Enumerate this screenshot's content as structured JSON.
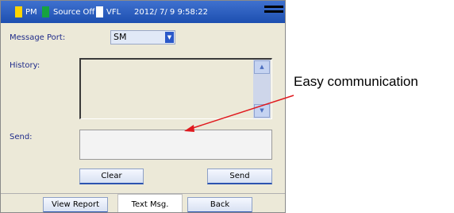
{
  "status_bar": {
    "pm_label": "PM",
    "source_label": "Source Off",
    "vfl_label": "VFL",
    "datetime": "2012/ 7/ 9  9:58:22",
    "colors": {
      "pm": "#ffd400",
      "source": "#16a340",
      "vfl": "#ffffff",
      "bar": "#1d4fb0"
    }
  },
  "form": {
    "message_port_label": "Message Port:",
    "message_port_value": "SM",
    "history_label": "History:",
    "send_label": "Send:"
  },
  "buttons": {
    "clear": "Clear",
    "send": "Send"
  },
  "tabs": [
    {
      "label": "View Report",
      "active": false
    },
    {
      "label": "Text Msg.",
      "active": true
    },
    {
      "label": "Back",
      "active": false
    }
  ],
  "annotation": {
    "text": "Easy communication",
    "arrow_color": "#e0191e"
  },
  "icons": {
    "dropdown": "chevron-down-icon",
    "scroll_up": "scroll-up-icon",
    "scroll_down": "scroll-down-icon",
    "menu": "menu-icon"
  }
}
